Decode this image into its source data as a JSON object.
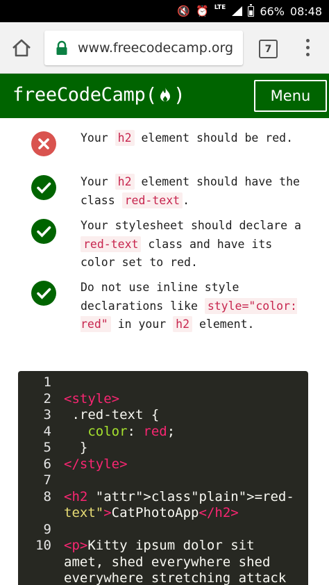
{
  "status_bar": {
    "icons": [
      "mute-icon",
      "alarm-icon",
      "lte-icon",
      "signal-icon",
      "battery-icon"
    ],
    "lte": "LTE",
    "battery": "66%",
    "time": "08:48"
  },
  "browser": {
    "url": "www.freecodecamp.org",
    "tab_count": "7",
    "icons": [
      "home-icon",
      "lock-icon",
      "tabs-icon",
      "overflow-menu-icon"
    ]
  },
  "navbar": {
    "logo_text": "freeCodeCamp",
    "logo_open": "(",
    "logo_close": ")",
    "menu_label": "Menu",
    "colors": {
      "background": "#006400",
      "text": "#ffffff"
    }
  },
  "tests": [
    {
      "status": "fail",
      "segments": [
        {
          "t": "Your "
        },
        {
          "t": "h2",
          "code": true
        },
        {
          "t": " element should be red."
        }
      ]
    },
    {
      "status": "pass",
      "segments": [
        {
          "t": "Your "
        },
        {
          "t": "h2",
          "code": true
        },
        {
          "t": " element should have the class "
        },
        {
          "t": "red-text",
          "code": true
        },
        {
          "t": "."
        }
      ]
    },
    {
      "status": "pass",
      "segments": [
        {
          "t": "Your stylesheet should declare a "
        },
        {
          "t": "red-text",
          "code": true
        },
        {
          "t": " class and have its color set to red."
        }
      ]
    },
    {
      "status": "pass",
      "segments": [
        {
          "t": "Do not use inline style declarations like "
        },
        {
          "t": "style=\"color: red\"",
          "code": true
        },
        {
          "t": " in your "
        },
        {
          "t": "h2",
          "code": true
        },
        {
          "t": " element."
        }
      ]
    }
  ],
  "status_colors": {
    "fail": "#d9534f",
    "pass": "#006400"
  },
  "editor": {
    "lines": [
      {
        "n": "1",
        "text": ""
      },
      {
        "n": "2",
        "text": "<style>"
      },
      {
        "n": "3",
        "text": " .red-text {"
      },
      {
        "n": "4",
        "text": "   color: red;"
      },
      {
        "n": "5",
        "text": "  }"
      },
      {
        "n": "6",
        "text": "</style>"
      },
      {
        "n": "7",
        "text": ""
      },
      {
        "n": "8",
        "text": "<h2 class=\"red-\ntext\">CatPhotoApp</h2>"
      },
      {
        "n": "9",
        "text": ""
      },
      {
        "n": "10",
        "text": "<p>Kitty ipsum dolor sit\namet, shed everywhere shed\neverywhere stretching attack"
      }
    ]
  }
}
